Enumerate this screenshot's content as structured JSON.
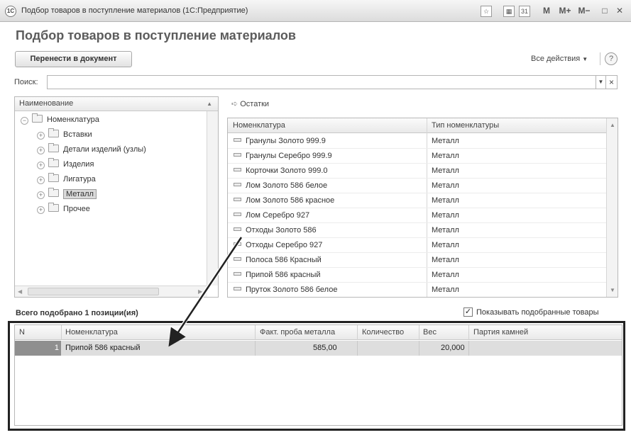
{
  "window": {
    "app_logo": "1С",
    "title": "Подбор товаров в поступление материалов  (1С:Предприятие)",
    "buttons": [
      "M",
      "M+",
      "M−"
    ]
  },
  "page_title": "Подбор товаров в поступление материалов",
  "toolbar": {
    "transfer_label": "Перенести в документ",
    "all_actions_label": "Все действия",
    "help_label": "?"
  },
  "search": {
    "label": "Поиск:",
    "value": ""
  },
  "tree": {
    "header": "Наименование",
    "root": "Номенклатура",
    "items": [
      {
        "label": "Вставки"
      },
      {
        "label": "Детали изделий (узлы)"
      },
      {
        "label": "Изделия"
      },
      {
        "label": "Лигатура"
      },
      {
        "label": "Металл"
      },
      {
        "label": "Прочее"
      }
    ],
    "selected": "Металл"
  },
  "remainders_label": "Остатки",
  "products": {
    "columns": [
      "Номенклатура",
      "Тип номенклатуры"
    ],
    "rows": [
      {
        "name": "Гранулы Золото 999.9",
        "type": "Металл"
      },
      {
        "name": "Гранулы Серебро 999.9",
        "type": "Металл"
      },
      {
        "name": "Корточки Золото 999.0",
        "type": "Металл"
      },
      {
        "name": "Лом Золото 586 белое",
        "type": "Металл"
      },
      {
        "name": "Лом Золото 586 красное",
        "type": "Металл"
      },
      {
        "name": "Лом Серебро 927",
        "type": "Металл"
      },
      {
        "name": "Отходы Золото 586",
        "type": "Металл"
      },
      {
        "name": "Отходы Серебро 927",
        "type": "Металл"
      },
      {
        "name": "Полоса 586 Красный",
        "type": "Металл"
      },
      {
        "name": "Припой 586 красный",
        "type": "Металл"
      },
      {
        "name": "Пруток Золото 586 белое",
        "type": "Металл"
      }
    ]
  },
  "total_label": "Всего подобрано 1 позиции(ия)",
  "show_selected": {
    "label": "Показывать подобранные товары",
    "checked": true
  },
  "selected_table": {
    "columns": [
      "N",
      "Номенклатура",
      "Факт. проба металла",
      "Количество",
      "Вес",
      "Партия камней"
    ],
    "rows": [
      {
        "n": "1",
        "name": "Припой 586 красный",
        "purity": "585,00",
        "qty": "",
        "weight": "20,000",
        "batch": ""
      }
    ]
  }
}
